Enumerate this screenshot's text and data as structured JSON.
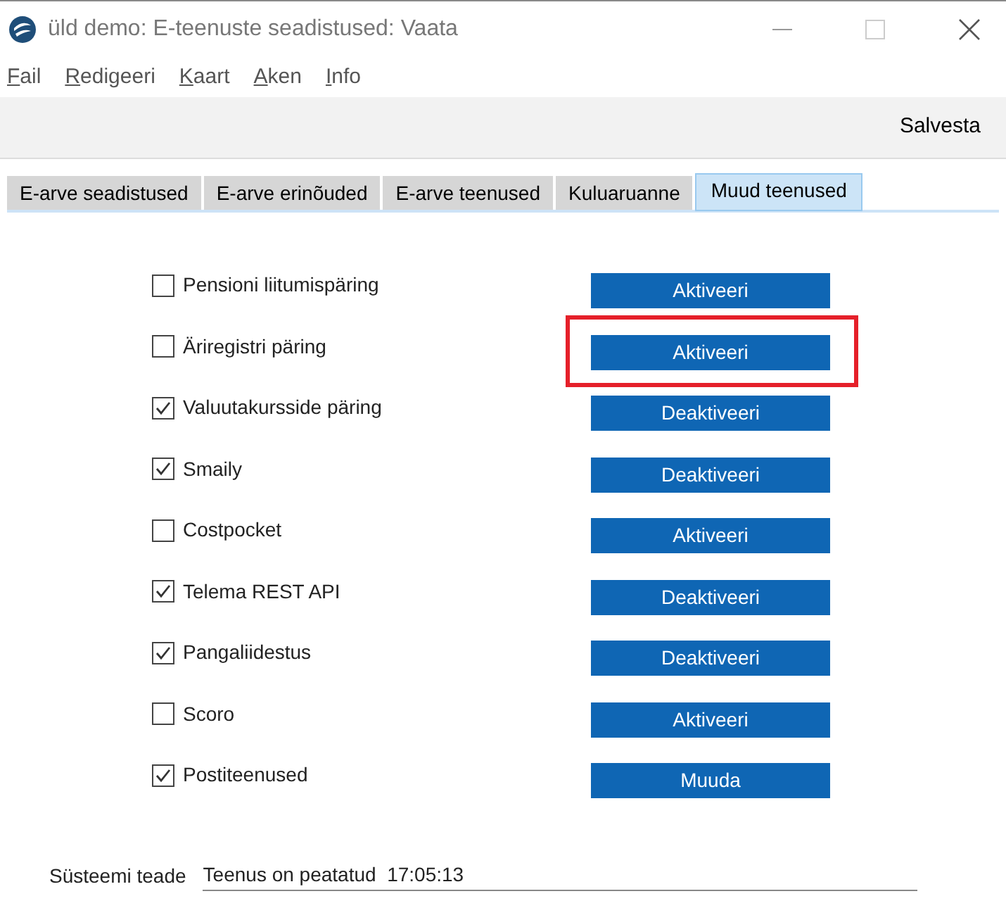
{
  "window": {
    "title": "üld demo: E-teenuste seadistused: Vaata"
  },
  "menu": [
    "Fail",
    "Redigeeri",
    "Kaart",
    "Aken",
    "Info"
  ],
  "toolbar": {
    "save": "Salvesta"
  },
  "tabs": [
    {
      "label": "E-arve seadistused",
      "selected": false
    },
    {
      "label": "E-arve erinõuded",
      "selected": false
    },
    {
      "label": "E-arve teenused",
      "selected": false
    },
    {
      "label": "Kuluaruanne",
      "selected": false
    },
    {
      "label": "Muud teenused",
      "selected": true
    }
  ],
  "services": [
    {
      "name": "Pensioni liitumispäring",
      "checked": false,
      "action": "Aktiveeri",
      "highlighted": false
    },
    {
      "name": "Äriregistri päring",
      "checked": false,
      "action": "Aktiveeri",
      "highlighted": true
    },
    {
      "name": "Valuutakursside päring",
      "checked": true,
      "action": "Deaktiveeri",
      "highlighted": false
    },
    {
      "name": "Smaily",
      "checked": true,
      "action": "Deaktiveeri",
      "highlighted": false
    },
    {
      "name": "Costpocket",
      "checked": false,
      "action": "Aktiveeri",
      "highlighted": false
    },
    {
      "name": "Telema REST API",
      "checked": true,
      "action": "Deaktiveeri",
      "highlighted": false
    },
    {
      "name": "Pangaliidestus",
      "checked": true,
      "action": "Deaktiveeri",
      "highlighted": false
    },
    {
      "name": "Scoro",
      "checked": false,
      "action": "Aktiveeri",
      "highlighted": false
    },
    {
      "name": "Postiteenused",
      "checked": true,
      "action": "Muuda",
      "highlighted": false
    }
  ],
  "system_message": {
    "label": "Süsteemi teade",
    "value": "Teenus on peatatud  17:05:13"
  }
}
